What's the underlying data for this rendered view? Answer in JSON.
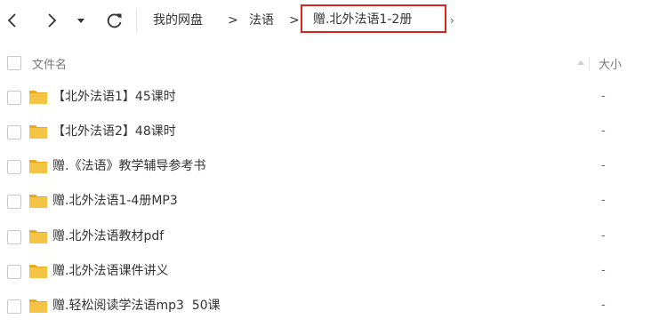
{
  "toolbar": {
    "icons": [
      "back-icon",
      "forward-icon",
      "history-dropdown-icon",
      "refresh-icon"
    ],
    "breadcrumb": {
      "items": [
        "我的网盘",
        "法语"
      ],
      "separator": ">",
      "current": "赠.北外法语1-2册",
      "more": "›"
    },
    "highlight_color": "#d9241b"
  },
  "header": {
    "name_label": "文件名",
    "size_label": "大小"
  },
  "files": [
    {
      "name": "【北外法语1】45课时",
      "size": "-"
    },
    {
      "name": "【北外法语2】48课时",
      "size": "-"
    },
    {
      "name": "赠.《法语》教学辅导参考书",
      "size": "-"
    },
    {
      "name": "赠.北外法语1-4册MP3",
      "size": "-"
    },
    {
      "name": "赠.北外法语教材pdf",
      "size": "-"
    },
    {
      "name": "赠.北外法语课件讲义",
      "size": "-"
    },
    {
      "name": "赠.轻松阅读学法语mp3  50课",
      "size": "-"
    }
  ],
  "colors": {
    "folder": "#f6c445",
    "folder_tab": "#e9a91f"
  }
}
